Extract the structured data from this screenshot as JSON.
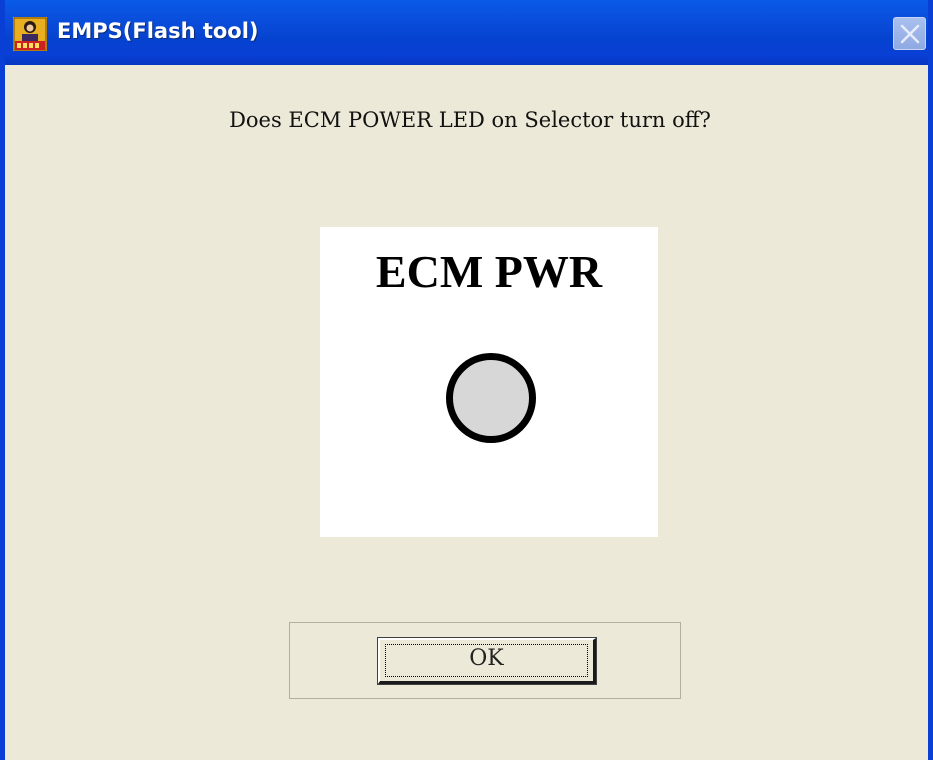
{
  "window": {
    "title": "EMPS(Flash tool)",
    "app_icon": "emps-app-icon",
    "close_icon": "close-icon",
    "colors": {
      "titlebar": "#0a3fd6",
      "client_background": "#ece9d8",
      "close_button": "#8fa9e4"
    }
  },
  "dialog": {
    "question": "Does ECM POWER LED on Selector turn off?",
    "indicator": {
      "label": "ECM PWR",
      "led_state": "off",
      "led_color": "#d7d7d7"
    },
    "ok_label": "OK"
  }
}
